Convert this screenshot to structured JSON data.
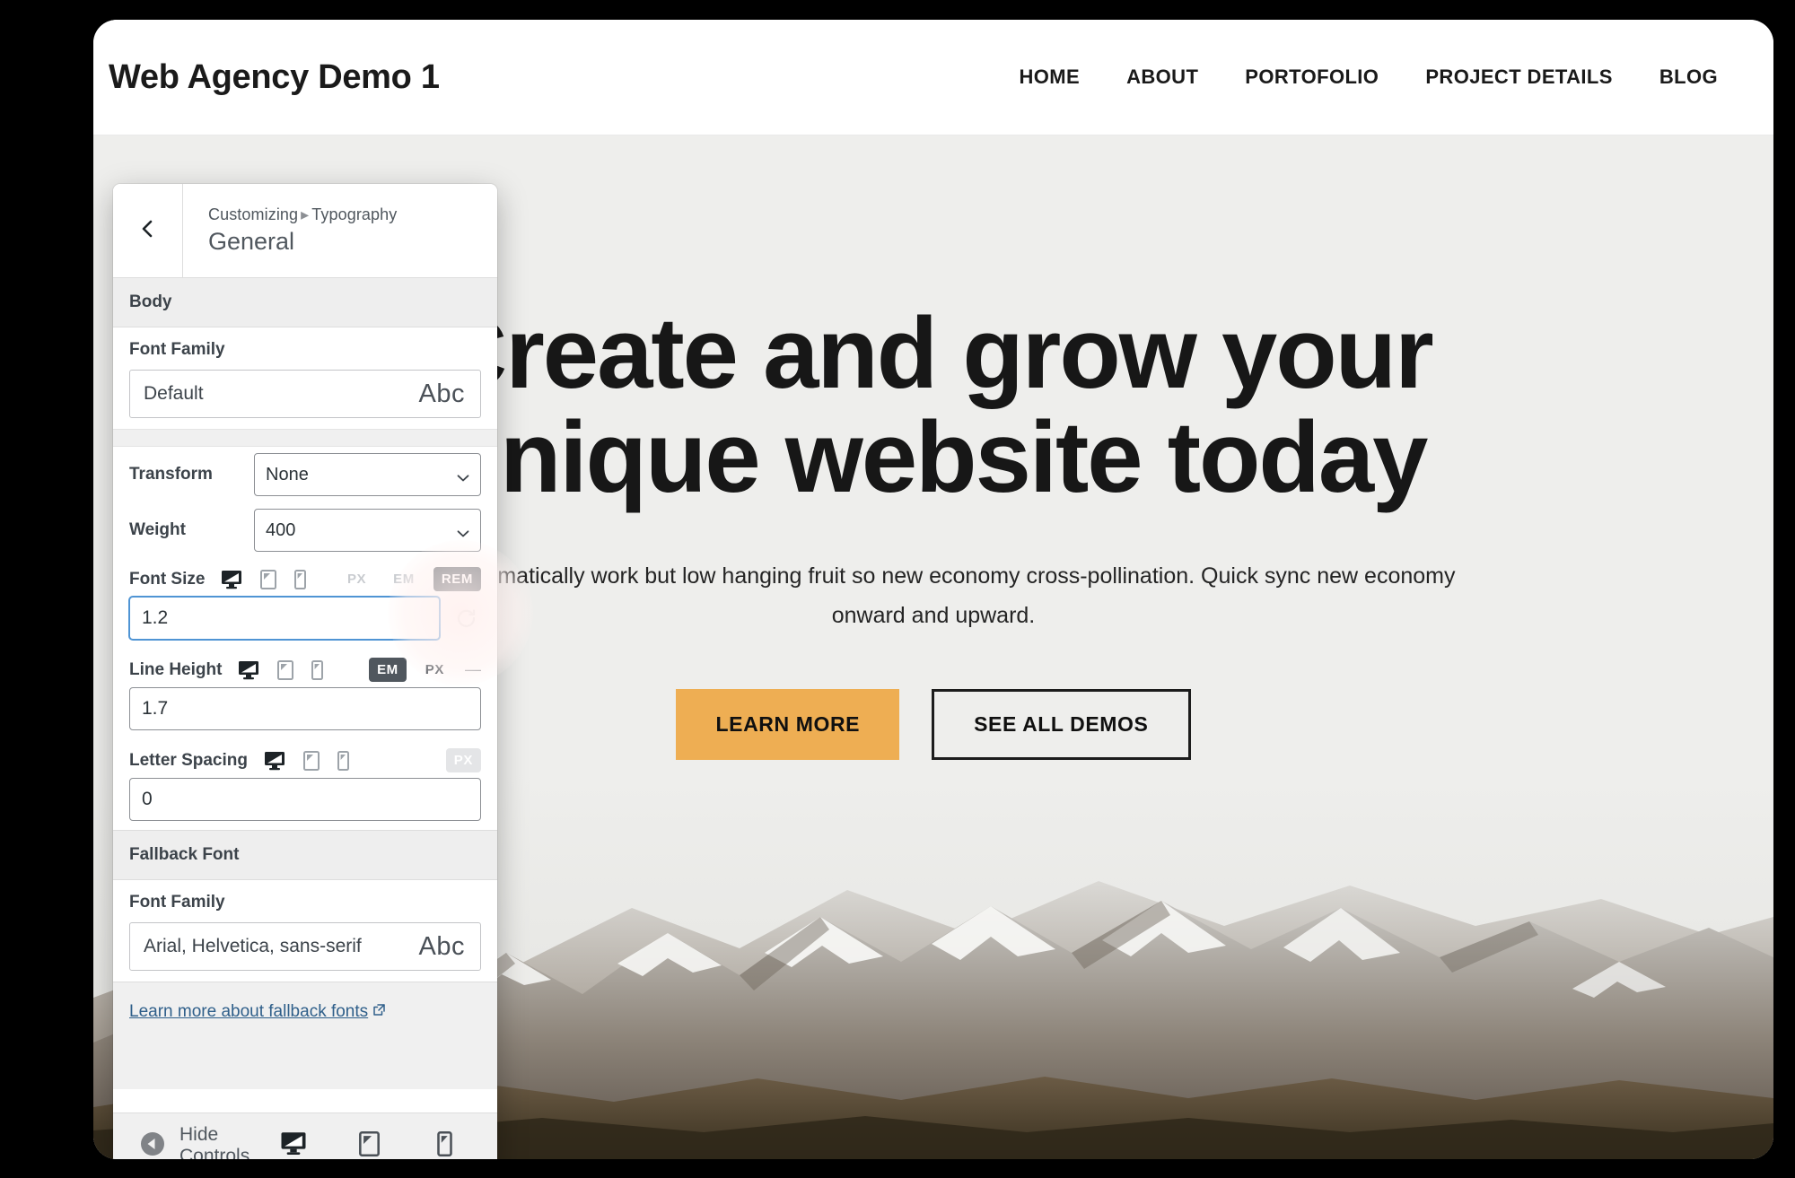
{
  "site": {
    "title": "Web Agency Demo 1",
    "nav": [
      {
        "label": "HOME"
      },
      {
        "label": "ABOUT"
      },
      {
        "label": "PORTOFOLIO"
      },
      {
        "label": "PROJECT DETAILS"
      },
      {
        "label": "BLOG"
      }
    ],
    "hero": {
      "heading": "Create and grow your unique website today",
      "subheading": "Programmatically work but low hanging fruit so new economy cross-pollination. Quick sync new economy onward and upward.",
      "primary_button": "LEARN MORE",
      "secondary_button": "SEE ALL DEMOS",
      "primary_button_color": "#eeae53",
      "background_color": "#eeeeec"
    }
  },
  "customizer": {
    "back_icon": "chevron-left-icon",
    "breadcrumb_root": "Customizing",
    "breadcrumb_separator": "▸",
    "breadcrumb_current": "Typography",
    "section_title": "General",
    "groups": [
      {
        "heading": "Body",
        "font_family_label": "Font Family",
        "font_family_value": "Default",
        "font_preview": "Abc",
        "transform_label": "Transform",
        "transform_value": "None",
        "weight_label": "Weight",
        "weight_value": "400",
        "font_size_label": "Font Size",
        "font_size_value": "1.2",
        "font_size_units": [
          "PX",
          "EM",
          "REM"
        ],
        "font_size_unit_active": "REM",
        "line_height_label": "Line Height",
        "line_height_value": "1.7",
        "line_height_units": [
          "EM",
          "PX"
        ],
        "line_height_unit_active": "EM",
        "line_height_extra": "—",
        "letter_spacing_label": "Letter Spacing",
        "letter_spacing_value": "0",
        "letter_spacing_units": [
          "PX"
        ],
        "letter_spacing_unit_active": "PX"
      },
      {
        "heading": "Fallback Font",
        "font_family_label": "Font Family",
        "font_family_value": "Arial, Helvetica, sans-serif",
        "font_preview": "Abc"
      }
    ],
    "fallback_link": "Learn more about fallback fonts",
    "fallback_link_icon": "external-link-icon",
    "devices": [
      {
        "name": "desktop",
        "icon": "desktop-icon",
        "active": true
      },
      {
        "name": "tablet",
        "icon": "tablet-icon",
        "active": false
      },
      {
        "name": "mobile",
        "icon": "mobile-icon",
        "active": false
      }
    ],
    "footer": {
      "hide_controls_label": "Hide Controls",
      "hide_controls_icon": "collapse-left-icon"
    },
    "accent_color": "#50575e",
    "focus_color": "#4f94d4"
  }
}
